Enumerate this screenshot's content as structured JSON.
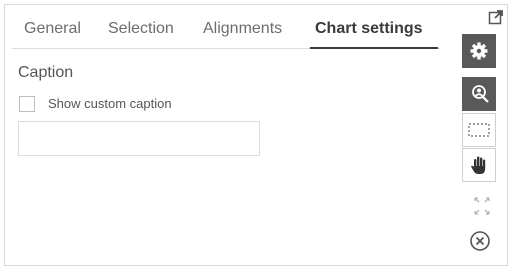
{
  "tabs": [
    {
      "label": "General"
    },
    {
      "label": "Selection"
    },
    {
      "label": "Alignments"
    },
    {
      "label": "Chart settings"
    }
  ],
  "active_tab": "Chart settings",
  "caption_section": {
    "title": "Caption",
    "checkbox_label": "Show custom caption",
    "checkbox_checked": false,
    "input_value": ""
  },
  "toolstrip": [
    {
      "icon": "gear-icon",
      "active": true
    },
    {
      "icon": "zoom-person-icon",
      "active": true
    },
    {
      "icon": "marquee-select-icon",
      "active": false
    },
    {
      "icon": "hand-pan-icon",
      "active": false
    }
  ],
  "colors": {
    "dark_button": "#595959",
    "text": "#555555"
  }
}
